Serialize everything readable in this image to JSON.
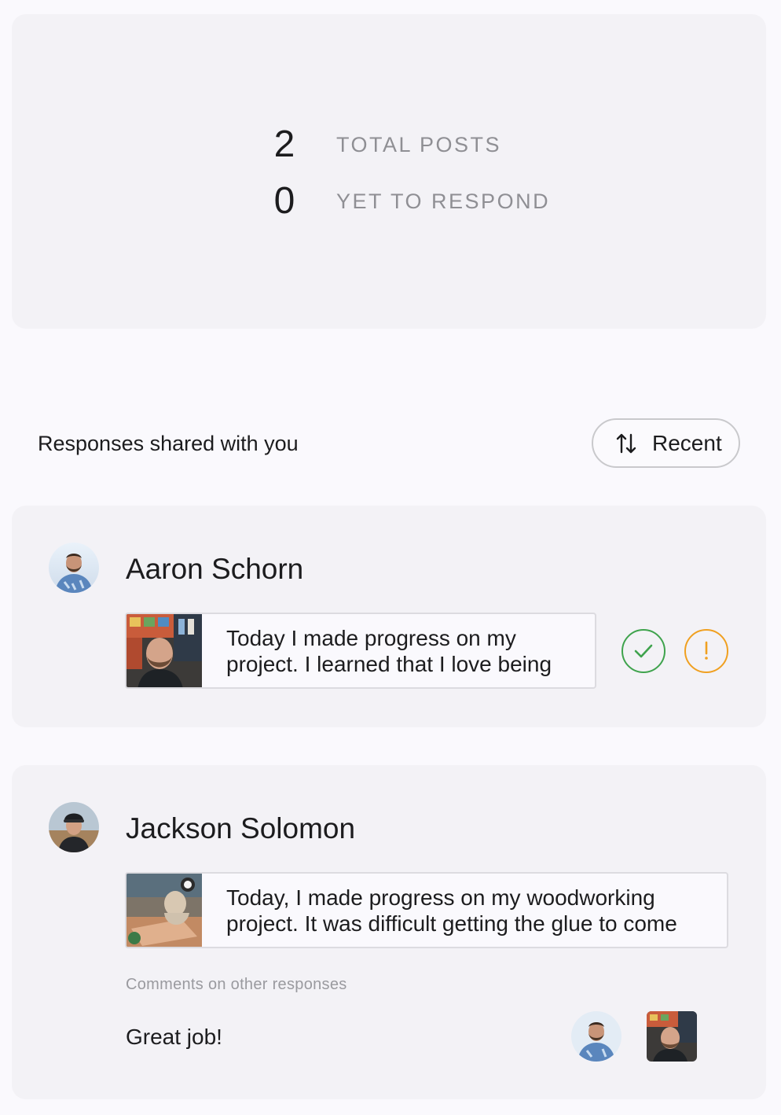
{
  "stats": {
    "total_posts_value": "2",
    "total_posts_label": "TOTAL POSTS",
    "yet_to_respond_value": "0",
    "yet_to_respond_label": "YET TO RESPOND"
  },
  "responses": {
    "title": "Responses shared with you",
    "sort_label": "Recent",
    "sort_icon": "sort-arrows-icon"
  },
  "posts": [
    {
      "name": "Aaron Schorn",
      "text": "Today I made progress on my project. I learned that I love being",
      "actions": [
        "check-icon",
        "exclamation-icon"
      ]
    },
    {
      "name": "Jackson Solomon",
      "text": "Today, I made progress on my woodworking project. It was difficult getting the glue to come",
      "comments_label": "Comments on other responses",
      "comment": "Great job!"
    }
  ],
  "colors": {
    "background": "#faf9fd",
    "card": "#f3f2f6",
    "check": "#3fa34d",
    "alert": "#f0a020",
    "muted": "#8f8f94"
  }
}
